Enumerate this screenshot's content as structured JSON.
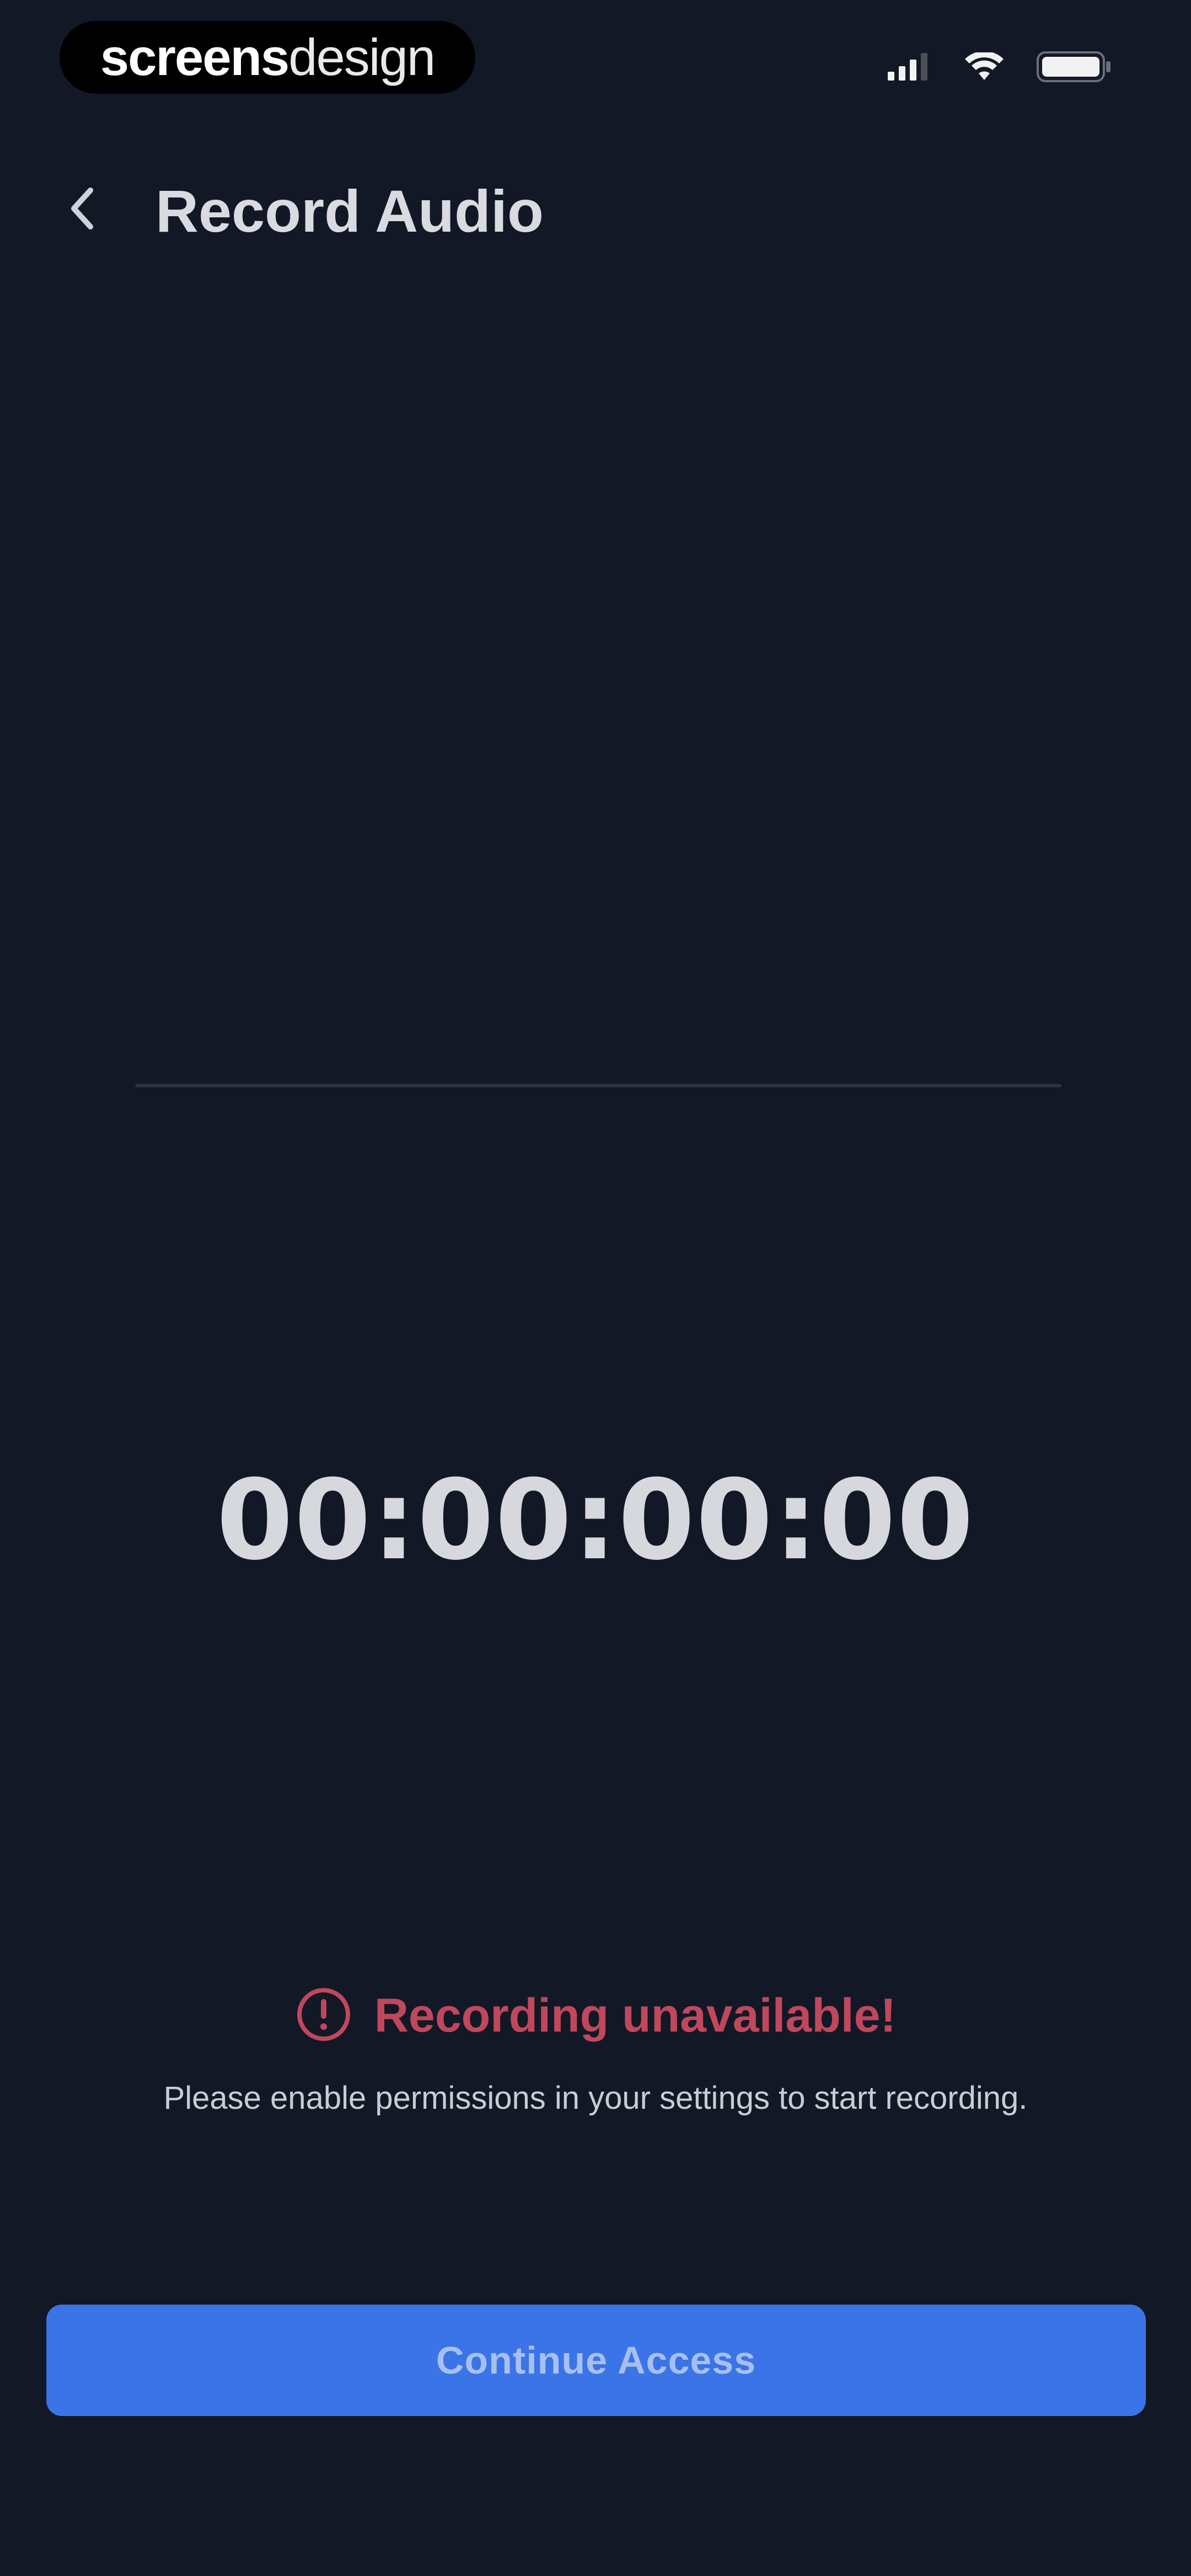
{
  "status_bar": {
    "brand_part1": "screens",
    "brand_part2": "design",
    "icons": [
      "signal-icon",
      "wifi-icon",
      "battery-icon"
    ]
  },
  "nav": {
    "title": "Record Audio",
    "back_icon": "chevron-left-icon"
  },
  "recorder": {
    "timer": "00:00:00:00"
  },
  "error": {
    "icon": "alert-circle-icon",
    "title": "Recording unavailable!",
    "description": "Please enable permissions in your settings to start recording."
  },
  "actions": {
    "continue_label": "Continue Access"
  },
  "colors": {
    "background": "#121826",
    "accent": "#3b74e6",
    "error": "#c0475c"
  }
}
